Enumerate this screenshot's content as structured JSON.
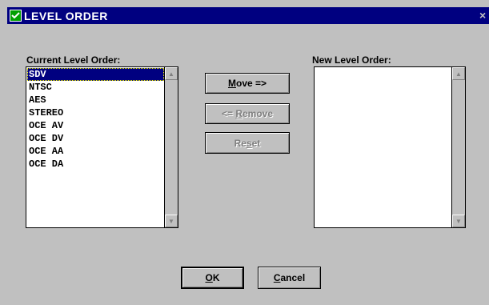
{
  "window": {
    "title": "LEVEL ORDER",
    "close_glyph": "×"
  },
  "current": {
    "label": "Current Level Order:",
    "items": [
      "SDV",
      "NTSC",
      "AES",
      "STEREO",
      "OCE AV",
      "OCE DV",
      "OCE AA",
      "OCE DA"
    ],
    "selected_index": 0
  },
  "new": {
    "label": "New Level Order:",
    "items": []
  },
  "buttons": {
    "move": {
      "mnemonic": "M",
      "rest": "ove =>"
    },
    "remove": {
      "prefix": "<= ",
      "mnemonic": "R",
      "rest": "emove"
    },
    "reset": {
      "prefix": "Re",
      "mnemonic": "s",
      "rest": "et"
    },
    "ok": {
      "mnemonic": "O",
      "rest": "K"
    },
    "cancel": {
      "mnemonic": "C",
      "rest": "ancel"
    }
  },
  "icons": {
    "app": "check-icon",
    "scroll_up": "arrow-up-icon",
    "scroll_down": "arrow-down-icon"
  }
}
